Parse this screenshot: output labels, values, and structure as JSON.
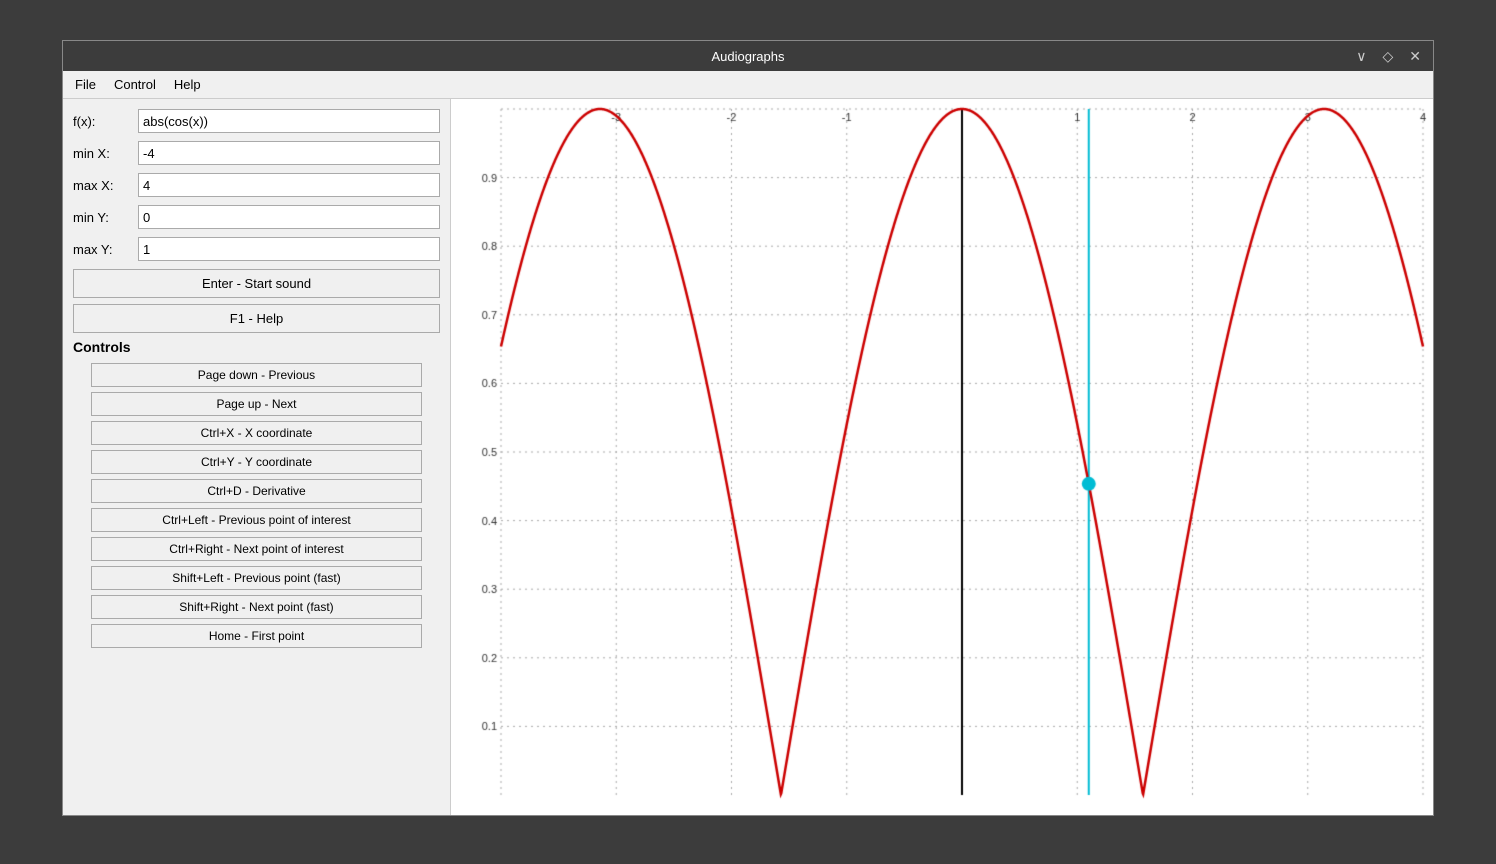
{
  "window": {
    "title": "Audiographs",
    "titlebar_buttons": [
      "∨",
      "◇",
      "✕"
    ]
  },
  "menubar": {
    "items": [
      "File",
      "Control",
      "Help"
    ]
  },
  "form": {
    "fx_label": "f(x):",
    "fx_value": "abs(cos(x))",
    "minx_label": "min X:",
    "minx_value": "-4",
    "maxx_label": "max X:",
    "maxx_value": "4",
    "miny_label": "min Y:",
    "miny_value": "0",
    "maxy_label": "max Y:",
    "maxy_value": "1"
  },
  "buttons": {
    "enter_sound": "Enter - Start sound",
    "help": "F1 - Help"
  },
  "controls": {
    "label": "Controls",
    "items": [
      "Page down - Previous",
      "Page up - Next",
      "Ctrl+X - X coordinate",
      "Ctrl+Y - Y coordinate",
      "Ctrl+D - Derivative",
      "Ctrl+Left - Previous point of interest",
      "Ctrl+Right - Next point of interest",
      "Shift+Left - Previous point (fast)",
      "Shift+Right - Next point (fast)",
      "Home - First point"
    ]
  },
  "graph": {
    "x_labels": [
      "-3",
      "-2",
      "-1",
      "",
      "1",
      "2",
      "3",
      "4"
    ],
    "y_labels": [
      "0.9",
      "0.8",
      "0.7",
      "0.6",
      "0.5",
      "0.4",
      "0.3",
      "0.2",
      "0.1"
    ],
    "cursor_x": 1.1,
    "cursor_y": 0.4536,
    "black_line_x": 0,
    "cyan_line_x": 1.1
  }
}
